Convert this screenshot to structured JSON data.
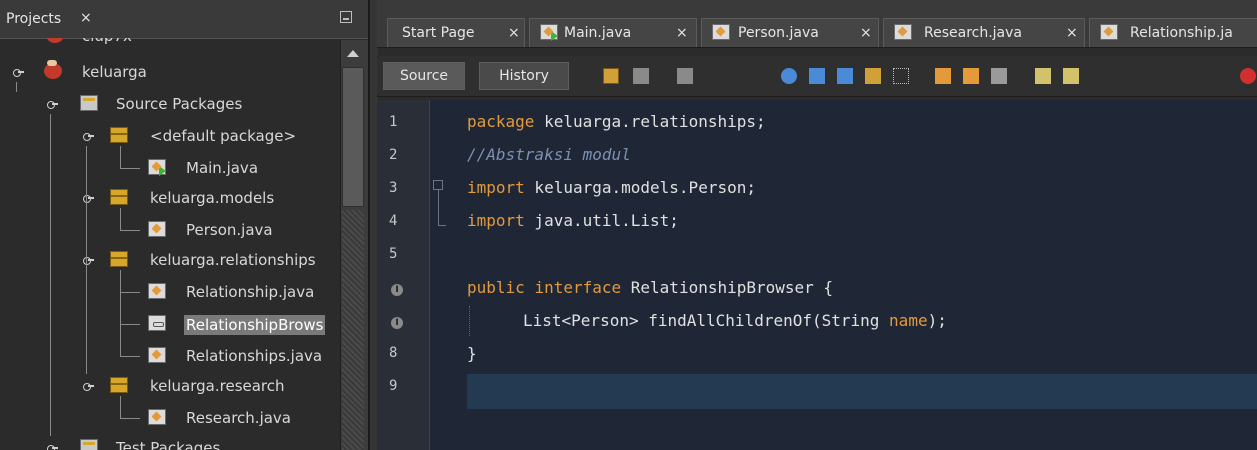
{
  "projects_panel": {
    "title": "Projects",
    "close_glyph": "×"
  },
  "tree": {
    "top_cut_label": "clup7x",
    "project": "keluarga",
    "source_packages": "Source Packages",
    "packages": [
      {
        "name": "<default package>",
        "files": [
          "Main.java"
        ]
      },
      {
        "name": "keluarga.models",
        "files": [
          "Person.java"
        ]
      },
      {
        "name": "keluarga.relationships",
        "files": [
          "Relationship.java",
          "RelationshipBrows",
          "Relationships.java"
        ]
      },
      {
        "name": "keluarga.research",
        "files": [
          "Research.java"
        ]
      }
    ],
    "test_packages": "Test Packages",
    "selected_file": "RelationshipBrows"
  },
  "tabs": [
    {
      "label": "Start Page",
      "close": "×"
    },
    {
      "label": "Main.java",
      "close": "×"
    },
    {
      "label": "Person.java",
      "close": "×"
    },
    {
      "label": "Research.java",
      "close": "×"
    },
    {
      "label": "Relationship.ja",
      "close": ""
    }
  ],
  "toolbar": {
    "source_label": "Source",
    "history_label": "History"
  },
  "editor": {
    "line_numbers": [
      "1",
      "2",
      "3",
      "4",
      "5",
      "",
      "",
      "8",
      "9"
    ],
    "override_marker": "I",
    "lines": {
      "l1_kw": "package",
      "l1_rest": " keluarga.relationships;",
      "l2_comment": "//Abstraksi modul",
      "l3_kw": "import",
      "l3_rest": " keluarga.models.Person;",
      "l4_kw": "import",
      "l4_rest": " java.util.List;",
      "l6_kw1": "public",
      "l6_kw2": "interface",
      "l6_rest": " RelationshipBrowser {",
      "l7_pre": "List<Person> findAllChildrenOf(String ",
      "l7_param": "name",
      "l7_post": ");",
      "l8": "}"
    }
  },
  "colors": {
    "keyword": "#e39a3b",
    "comment": "#7d8fb3",
    "editor_bg": "#1f2736",
    "caret_line": "#243a52"
  }
}
